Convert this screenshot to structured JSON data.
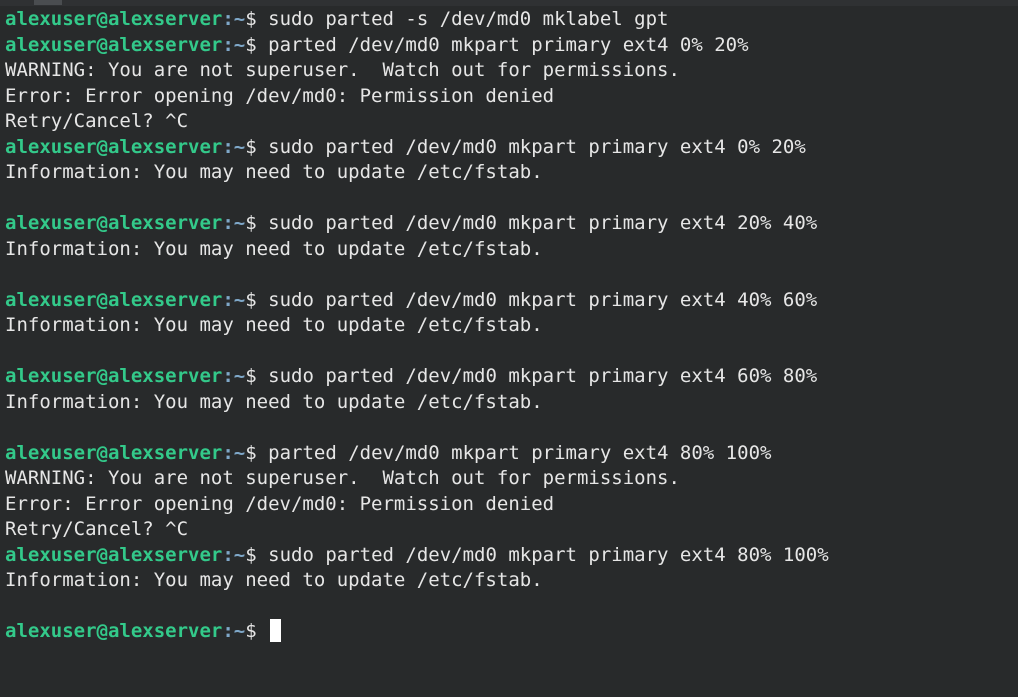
{
  "prompt": {
    "user": "alexuser@alexserver",
    "path": ":~",
    "symbol": "$"
  },
  "lines": [
    {
      "type": "cmd",
      "text": " sudo parted -s /dev/md0 mklabel gpt"
    },
    {
      "type": "cmd",
      "text": " parted /dev/md0 mkpart primary ext4 0% 20%"
    },
    {
      "type": "out",
      "text": "WARNING: You are not superuser.  Watch out for permissions."
    },
    {
      "type": "out",
      "text": "Error: Error opening /dev/md0: Permission denied"
    },
    {
      "type": "out",
      "text": "Retry/Cancel? ^C"
    },
    {
      "type": "cmd",
      "text": " sudo parted /dev/md0 mkpart primary ext4 0% 20%"
    },
    {
      "type": "out",
      "text": "Information: You may need to update /etc/fstab."
    },
    {
      "type": "out",
      "text": ""
    },
    {
      "type": "cmd",
      "text": " sudo parted /dev/md0 mkpart primary ext4 20% 40%"
    },
    {
      "type": "out",
      "text": "Information: You may need to update /etc/fstab."
    },
    {
      "type": "out",
      "text": ""
    },
    {
      "type": "cmd",
      "text": " sudo parted /dev/md0 mkpart primary ext4 40% 60%"
    },
    {
      "type": "out",
      "text": "Information: You may need to update /etc/fstab."
    },
    {
      "type": "out",
      "text": ""
    },
    {
      "type": "cmd",
      "text": " sudo parted /dev/md0 mkpart primary ext4 60% 80%"
    },
    {
      "type": "out",
      "text": "Information: You may need to update /etc/fstab."
    },
    {
      "type": "out",
      "text": ""
    },
    {
      "type": "cmd",
      "text": " parted /dev/md0 mkpart primary ext4 80% 100%"
    },
    {
      "type": "out",
      "text": "WARNING: You are not superuser.  Watch out for permissions."
    },
    {
      "type": "out",
      "text": "Error: Error opening /dev/md0: Permission denied"
    },
    {
      "type": "out",
      "text": "Retry/Cancel? ^C"
    },
    {
      "type": "cmd",
      "text": " sudo parted /dev/md0 mkpart primary ext4 80% 100%"
    },
    {
      "type": "out",
      "text": "Information: You may need to update /etc/fstab."
    },
    {
      "type": "out",
      "text": ""
    },
    {
      "type": "cmd",
      "text": " ",
      "cursor": true
    }
  ],
  "colors": {
    "background": "#282a2b",
    "user": "#33c98a",
    "path": "#7fa8c9",
    "text": "#e6e6e6"
  }
}
